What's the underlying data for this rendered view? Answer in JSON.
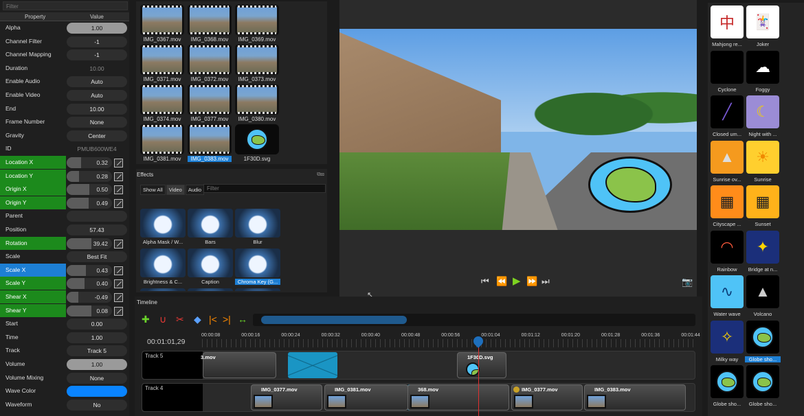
{
  "properties": {
    "filter_placeholder": "Filter",
    "col_property": "Property",
    "col_value": "Value",
    "rows": [
      {
        "name": "Alpha",
        "value": "1.00",
        "style": "lit"
      },
      {
        "name": "Channel Filter",
        "value": "-1",
        "style": "plain"
      },
      {
        "name": "Channel Mapping",
        "value": "-1",
        "style": "plain"
      },
      {
        "name": "Duration",
        "value": "10.00",
        "style": "dim"
      },
      {
        "name": "Enable Audio",
        "value": "Auto",
        "style": "plain"
      },
      {
        "name": "Enable Video",
        "value": "Auto",
        "style": "plain"
      },
      {
        "name": "End",
        "value": "10.00",
        "style": "plain"
      },
      {
        "name": "Frame Number",
        "value": "None",
        "style": "plain"
      },
      {
        "name": "Gravity",
        "value": "Center",
        "style": "plain"
      },
      {
        "name": "ID",
        "value": "PMUB600WE4",
        "style": "dim"
      },
      {
        "name": "Location X",
        "value": "0.32",
        "style": "slider",
        "hl": "green",
        "fill": 0.32
      },
      {
        "name": "Location Y",
        "value": "0.28",
        "style": "slider",
        "hl": "green",
        "fill": 0.28
      },
      {
        "name": "Origin X",
        "value": "0.50",
        "style": "slider",
        "hl": "green",
        "fill": 0.5
      },
      {
        "name": "Origin Y",
        "value": "0.49",
        "style": "slider",
        "hl": "green",
        "fill": 0.49
      },
      {
        "name": "Parent",
        "value": "",
        "style": "plain"
      },
      {
        "name": "Position",
        "value": "57.43",
        "style": "plain"
      },
      {
        "name": "Rotation",
        "value": "39.42",
        "style": "slider",
        "hl": "green",
        "fill": 0.55
      },
      {
        "name": "Scale",
        "value": "Best Fit",
        "style": "plain"
      },
      {
        "name": "Scale X",
        "value": "0.43",
        "style": "slider",
        "hl": "blue",
        "fill": 0.43
      },
      {
        "name": "Scale Y",
        "value": "0.40",
        "style": "slider",
        "hl": "green",
        "fill": 0.4
      },
      {
        "name": "Shear X",
        "value": "-0.49",
        "style": "slider",
        "hl": "green",
        "fill": 0.26
      },
      {
        "name": "Shear Y",
        "value": "0.08",
        "style": "slider",
        "hl": "green",
        "fill": 0.54
      },
      {
        "name": "Start",
        "value": "0.00",
        "style": "plain"
      },
      {
        "name": "Time",
        "value": "1.00",
        "style": "plain"
      },
      {
        "name": "Track",
        "value": "Track 5",
        "style": "plain"
      },
      {
        "name": "Volume",
        "value": "1.00",
        "style": "lit"
      },
      {
        "name": "Volume Mixing",
        "value": "None",
        "style": "plain"
      },
      {
        "name": "Wave Color",
        "value": "",
        "style": "color",
        "color": "#0a84ff"
      },
      {
        "name": "Waveform",
        "value": "No",
        "style": "plain"
      }
    ]
  },
  "files": [
    {
      "label": "IMG_0367.mov"
    },
    {
      "label": "IMG_0368.mov"
    },
    {
      "label": "IMG_0369.mov"
    },
    {
      "label": "IMG_0371.mov"
    },
    {
      "label": "IMG_0372.mov"
    },
    {
      "label": "IMG_0373.mov"
    },
    {
      "label": "IMG_0374.mov"
    },
    {
      "label": "IMG_0377.mov"
    },
    {
      "label": "IMG_0380.mov"
    },
    {
      "label": "IMG_0381.mov"
    },
    {
      "label": "IMG_0383.mov",
      "selected": true
    },
    {
      "label": "1F30D.svg",
      "kind": "svg"
    }
  ],
  "effects": {
    "title": "Effects",
    "tabs": [
      "Show All",
      "Video",
      "Audio"
    ],
    "active_tab": "Video",
    "filter_placeholder": "Filter",
    "items": [
      {
        "label": "Alpha Mask / W..."
      },
      {
        "label": "Bars"
      },
      {
        "label": "Blur"
      },
      {
        "label": "Brightness & C..."
      },
      {
        "label": "Caption"
      },
      {
        "label": "Chroma Key (G...",
        "selected": true
      },
      {
        "label": ""
      },
      {
        "label": ""
      },
      {
        "label": ""
      }
    ]
  },
  "transport": {
    "icons": [
      "jump-start-icon",
      "rewind-icon",
      "play-icon",
      "fast-forward-icon",
      "jump-end-icon"
    ]
  },
  "emoji": [
    {
      "label": "Mahjong re...",
      "glyph": "中",
      "bg": "#ffffff",
      "fg": "#c62828"
    },
    {
      "label": "Joker",
      "glyph": "🃏",
      "bg": "#ffffff",
      "fg": "#000"
    },
    {
      "label": "Cyclone",
      "glyph": "",
      "bg": "#000000",
      "fg": "#000"
    },
    {
      "label": "Foggy",
      "glyph": "☁",
      "bg": "#000000",
      "fg": "#fff"
    },
    {
      "label": "Closed um...",
      "glyph": "╱",
      "bg": "#000000",
      "fg": "#7a5ad8"
    },
    {
      "label": "Night with ...",
      "glyph": "☾",
      "bg": "#9b8cd6",
      "fg": "#f5d000"
    },
    {
      "label": "Sunrise ov...",
      "glyph": "▲",
      "bg": "#f59a1e",
      "fg": "#ddd"
    },
    {
      "label": "Sunrise",
      "glyph": "☀",
      "bg": "#ffcf2e",
      "fg": "#f08a00"
    },
    {
      "label": "Cityscape ...",
      "glyph": "▦",
      "bg": "#ff8c1a",
      "fg": "#222"
    },
    {
      "label": "Sunset",
      "glyph": "▦",
      "bg": "#ffb21a",
      "fg": "#222"
    },
    {
      "label": "Rainbow",
      "glyph": "◠",
      "bg": "#000000",
      "fg": "#ff5a3c"
    },
    {
      "label": "Bridge at n...",
      "glyph": "✦",
      "bg": "#1b2f7a",
      "fg": "#ffd400"
    },
    {
      "label": "Water wave",
      "glyph": "∿",
      "bg": "#4fc3f7",
      "fg": "#0b3f7a"
    },
    {
      "label": "Volcano",
      "glyph": "▲",
      "bg": "#000000",
      "fg": "#ccc"
    },
    {
      "label": "Milky way",
      "glyph": "✧",
      "bg": "#1b2f7a",
      "fg": "#ffd400"
    },
    {
      "label": "Globe sho...",
      "glyph": "",
      "bg": "#000000",
      "fg": "#000",
      "globe": true,
      "selected": true
    },
    {
      "label": "Globe sho...",
      "glyph": "",
      "bg": "#000000",
      "fg": "#000",
      "globe": true
    },
    {
      "label": "Globe sho...",
      "glyph": "",
      "bg": "#000000",
      "fg": "#000",
      "globe": true
    }
  ],
  "timeline": {
    "title": "Timeline",
    "timecode": "00:01:01,29",
    "ticks": [
      "00:00:08",
      "00:00:16",
      "00:00:24",
      "00:00:32",
      "00:00:40",
      "00:00:48",
      "00:00:56",
      "00:01:04",
      "00:01:12",
      "00:01:20",
      "00:01:28",
      "00:01:36",
      "00:01:44"
    ],
    "tracks": [
      {
        "name": "Track 5",
        "clips": [
          {
            "label": "3.mov"
          },
          {
            "label": "1F30D.svg"
          }
        ]
      },
      {
        "name": "Track 4",
        "clips": [
          {
            "label": "IMG_0377.mov"
          },
          {
            "label": "IMG_0381.mov"
          },
          {
            "label": "368.mov"
          },
          {
            "label": "IMG_0377.mov"
          },
          {
            "label": "IMG_0383.mov"
          }
        ]
      }
    ]
  }
}
